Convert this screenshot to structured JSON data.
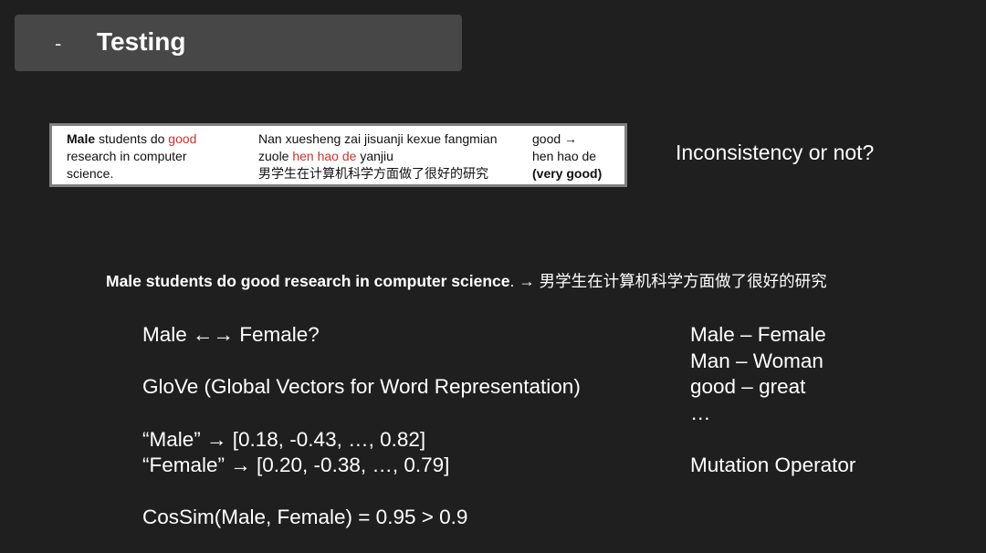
{
  "header": {
    "dash": "-",
    "title": "Testing"
  },
  "example": {
    "col1": {
      "w1": "Male",
      "w2": " students do ",
      "w3": "good",
      "line2": "research in computer",
      "line3": "science."
    },
    "col2": {
      "line1": "Nan xuesheng zai jisuanji kexue fangmian",
      "line2a": "zuole ",
      "line2b": "hen hao de",
      "line2c": " yanjiu",
      "line3": "男学生在计算机科学方面做了很好的研究"
    },
    "col3": {
      "line1": "good →",
      "line2": "hen hao de",
      "line3": "(very good)"
    }
  },
  "question": "Inconsistency or not?",
  "sentence": {
    "english": "Male students do good research in computer science",
    "rest": ". → 男学生在计算机科学方面做了很好的研究"
  },
  "left": {
    "q": "Male ←→ Female?",
    "glove": "GloVe (Global Vectors for Word Representation)",
    "vec_male": "“Male” → [0.18, -0.43, …, 0.82]",
    "vec_female": "“Female” → [0.20, -0.38, …, 0.79]",
    "cossim": "CosSim(Male, Female) = 0.95 > 0.9"
  },
  "right": {
    "pair1": "Male – Female",
    "pair2": "Man – Woman",
    "pair3": "good – great",
    "ellipsis": "…",
    "mutation": "Mutation Operator"
  }
}
